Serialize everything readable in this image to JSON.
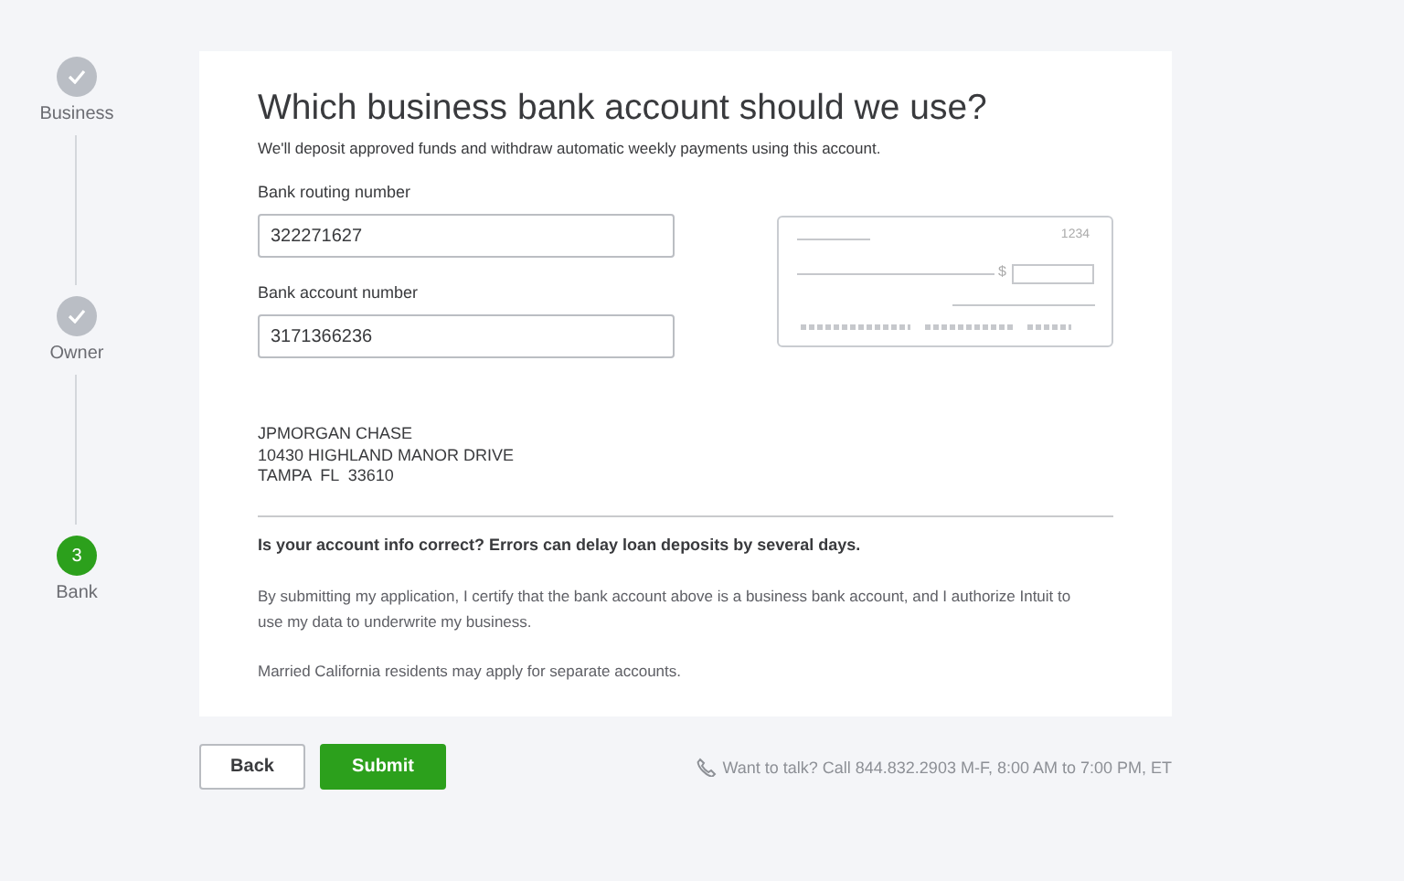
{
  "steps": [
    {
      "label": "Business",
      "kind": "done"
    },
    {
      "label": "Owner",
      "kind": "done"
    },
    {
      "label": "Bank",
      "kind": "current",
      "number": "3"
    }
  ],
  "title": "Which business bank account should we use?",
  "subtitle": "We'll deposit approved funds and withdraw automatic weekly payments using this account.",
  "fields": [
    {
      "label": "Bank routing number",
      "value": "322271627"
    },
    {
      "label": "Bank account number",
      "value": "3171366236"
    }
  ],
  "check": {
    "number": "1234",
    "currency": "$"
  },
  "bank_address": [
    "JPMORGAN CHASE",
    "10430 HIGHLAND MANOR DRIVE",
    "TAMPA  FL  33610"
  ],
  "warning": "Is your account info correct? Errors can delay loan deposits by several days.",
  "paragraphs": [
    "By submitting my application, I certify that the bank account above is a business bank account, and I authorize Intuit to use my data to underwrite my business.",
    "Married California residents may apply for separate accounts."
  ],
  "buttons": [
    {
      "label": "Back",
      "kind": "secondary"
    },
    {
      "label": "Submit",
      "kind": "primary"
    }
  ],
  "contact": "Want to talk? Call 844.832.2903 M-F, 8:00 AM to 7:00 PM, ET"
}
